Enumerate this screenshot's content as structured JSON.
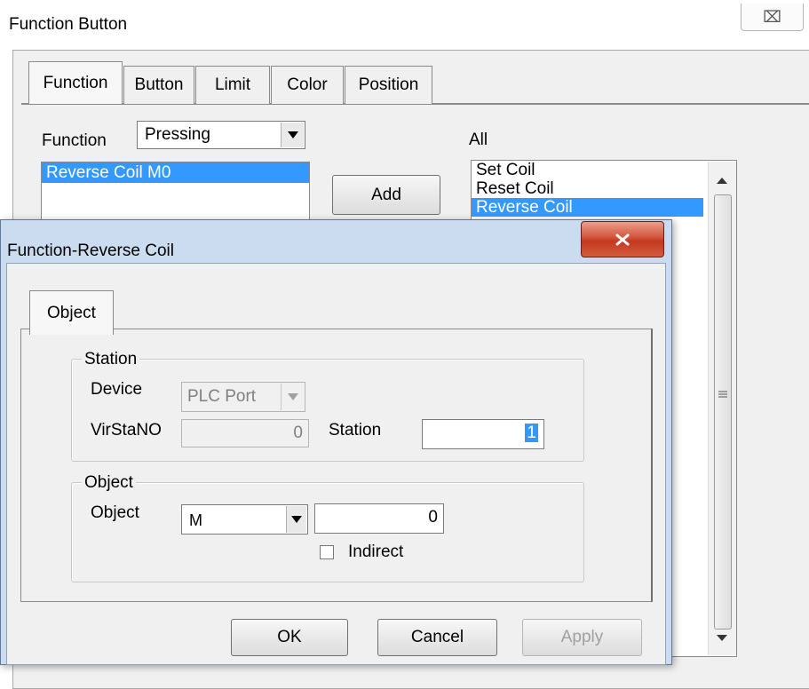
{
  "parent_window": {
    "title": "Function Button",
    "close_glyph": "⌧",
    "tabs": [
      {
        "label": "Function",
        "active": true
      },
      {
        "label": "Button",
        "active": false
      },
      {
        "label": "Limit",
        "active": false
      },
      {
        "label": "Color",
        "active": false
      },
      {
        "label": "Position",
        "active": false
      }
    ],
    "function_label": "Function",
    "function_mode": "Pressing",
    "selected_functions": [
      "Reverse Coil M0"
    ],
    "add_button": "Add",
    "all_label": "All",
    "all_list": [
      {
        "label": "Set Coil",
        "selected": false
      },
      {
        "label": "Reset Coil",
        "selected": false
      },
      {
        "label": "Reverse Coil",
        "selected": true
      }
    ]
  },
  "dialog": {
    "title": "Function-Reverse Coil",
    "tab": "Object",
    "station_group": {
      "legend": "Station",
      "device_label": "Device",
      "device_value": "PLC Port",
      "virsta_label": "VirStaNO",
      "virsta_value": "0",
      "station_label": "Station",
      "station_value": "1"
    },
    "object_group": {
      "legend": "Object",
      "object_label": "Object",
      "object_type": "M",
      "object_address": "0",
      "indirect_label": "Indirect",
      "indirect_checked": false
    },
    "buttons": {
      "ok": "OK",
      "cancel": "Cancel",
      "apply": "Apply"
    }
  },
  "colors": {
    "selection": "#3399ff",
    "close_red": "#c4391f",
    "dialog_frame": "#cbdcf0"
  }
}
